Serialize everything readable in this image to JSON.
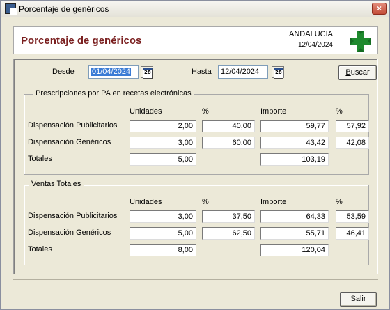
{
  "window": {
    "title": "Porcentaje de genéricos",
    "close_label": "×"
  },
  "header": {
    "title": "Porcentaje de genéricos",
    "region": "ANDALUCIA",
    "date": "12/04/2024",
    "cross_color": "#1f8a2e"
  },
  "filters": {
    "desde_label": "Desde",
    "desde_value": "01/04/2024",
    "hasta_label": "Hasta",
    "hasta_value": "12/04/2024",
    "calendar_day": "28",
    "buscar_prefix": "B",
    "buscar_rest": "uscar"
  },
  "prescripciones": {
    "legend": "Prescripciones por PA en recetas electrónicas",
    "col_unidades": "Unidades",
    "col_pct1": "%",
    "col_importe": "Importe",
    "col_pct2": "%",
    "rows": [
      {
        "label": "Dispensación Publicitarios",
        "unidades": "2,00",
        "pct1": "40,00",
        "importe": "59,77",
        "pct2": "57,92"
      },
      {
        "label": "Dispensación Genéricos",
        "unidades": "3,00",
        "pct1": "60,00",
        "importe": "43,42",
        "pct2": "42,08"
      },
      {
        "label": "Totales",
        "unidades": "5,00",
        "importe": "103,19"
      }
    ]
  },
  "ventas": {
    "legend": "Ventas Totales",
    "col_unidades": "Unidades",
    "col_pct1": "%",
    "col_importe": "Importe",
    "col_pct2": "%",
    "rows": [
      {
        "label": "Dispensación Publicitarios",
        "unidades": "3,00",
        "pct1": "37,50",
        "importe": "64,33",
        "pct2": "53,59"
      },
      {
        "label": "Dispensación Genéricos",
        "unidades": "5,00",
        "pct1": "62,50",
        "importe": "55,71",
        "pct2": "46,41"
      },
      {
        "label": "Totales",
        "unidades": "8,00",
        "importe": "120,04"
      }
    ]
  },
  "footer": {
    "salir_prefix": "S",
    "salir_rest": "alir"
  }
}
